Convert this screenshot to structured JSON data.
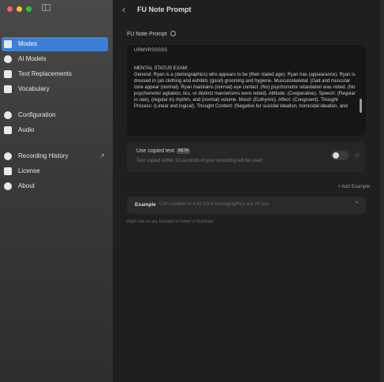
{
  "sidebar": {
    "items": [
      {
        "label": "Modes",
        "icon": "modes-icon",
        "active": true
      },
      {
        "label": "AI Models",
        "icon": "ai-models-icon"
      },
      {
        "label": "Text Replacements",
        "icon": "text-replacements-icon"
      },
      {
        "label": "Vocabulary",
        "icon": "vocabulary-icon"
      },
      {
        "label": "Configuration",
        "icon": "configuration-icon"
      },
      {
        "label": "Audio",
        "icon": "audio-icon"
      },
      {
        "label": "Recording History",
        "icon": "recording-history-icon",
        "external": "↗"
      },
      {
        "label": "License",
        "icon": "license-icon"
      },
      {
        "label": "About",
        "icon": "about-icon"
      }
    ]
  },
  "header": {
    "back": "‹",
    "title": "FU Note Prompt"
  },
  "prompt": {
    "label": "FU Note Prompt",
    "line1": "URMVRSSSSS",
    "heading": "MENTAL STATUS EXAM:",
    "body": "General: Ryan is a (demographics) who appears to be (their stated age). Ryan has (appearance). Ryan is dressed in (an clothing and exhibits (good) grooming and hygiene. Musculoskeletal: (Gait and muscular tone appear (normal). Ryan maintains (normal) eye contact. (No) psychomotor retardation was noted. (No psychomotor agitation, tics, or distinct mannerisms were noted). Attitude: (Cooperative). Speech: (Regular in rate), (regular in) rhythm, and (normal) volume. Mood: (Euthymic). Affect: (Congruent). Thought Process: (Linear and logical). Thought Content: (Negative for suicidal ideation, homicidal ideation, and"
  },
  "copied_text": {
    "title": "Use copied text",
    "badge": "BETA",
    "subtitle": "Text copied within 10 seconds of your recording will be used",
    "enabled": false
  },
  "add_example": "+ Add Example",
  "example": {
    "label": "Example",
    "text": "Call Location is 4-01-53-6 Demographics are 29 yoo",
    "chevron": "^"
  },
  "hint": "Right click on any Example to Delete or Duplicate"
}
